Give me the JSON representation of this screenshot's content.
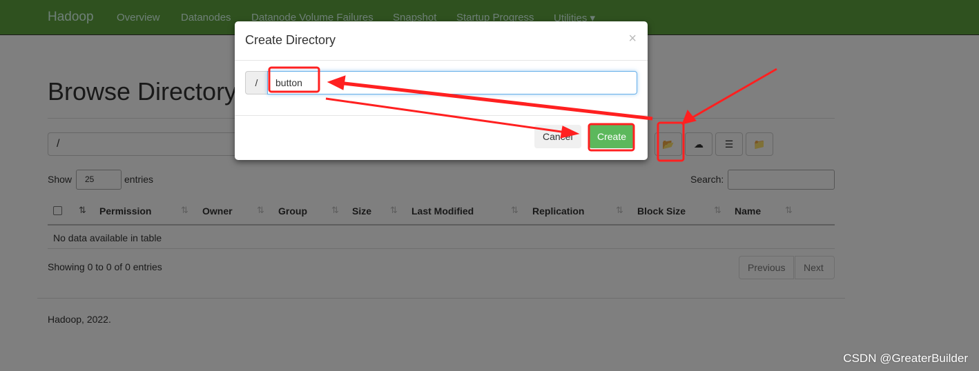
{
  "navbar": {
    "brand": "Hadoop",
    "items": [
      "Overview",
      "Datanodes",
      "Datanode Volume Failures",
      "Snapshot",
      "Startup Progress",
      "Utilities ▾"
    ]
  },
  "page": {
    "title": "Browse Directory",
    "path": "/",
    "toolbar_icons": [
      "folder-open-icon",
      "cloud-upload-icon",
      "list-icon",
      "folder-move-icon"
    ]
  },
  "table": {
    "show": "Show",
    "entries_select": "25",
    "entries": "entries",
    "search_label": "Search:",
    "columns": [
      "Permission",
      "Owner",
      "Group",
      "Size",
      "Last Modified",
      "Replication",
      "Block Size",
      "Name"
    ],
    "empty": "No data available in table",
    "info": "Showing 0 to 0 of 0 entries",
    "prev": "Previous",
    "next": "Next"
  },
  "footer": "Hadoop, 2022.",
  "modal": {
    "title": "Create Directory",
    "close": "×",
    "prefix": "/",
    "input_value": "button",
    "cancel": "Cancel",
    "create": "Create"
  },
  "watermark": "CSDN @GreaterBuilder",
  "colors": {
    "navbar": "#5fa33e",
    "create": "#5cb85c",
    "annotation": "#ff2020"
  }
}
